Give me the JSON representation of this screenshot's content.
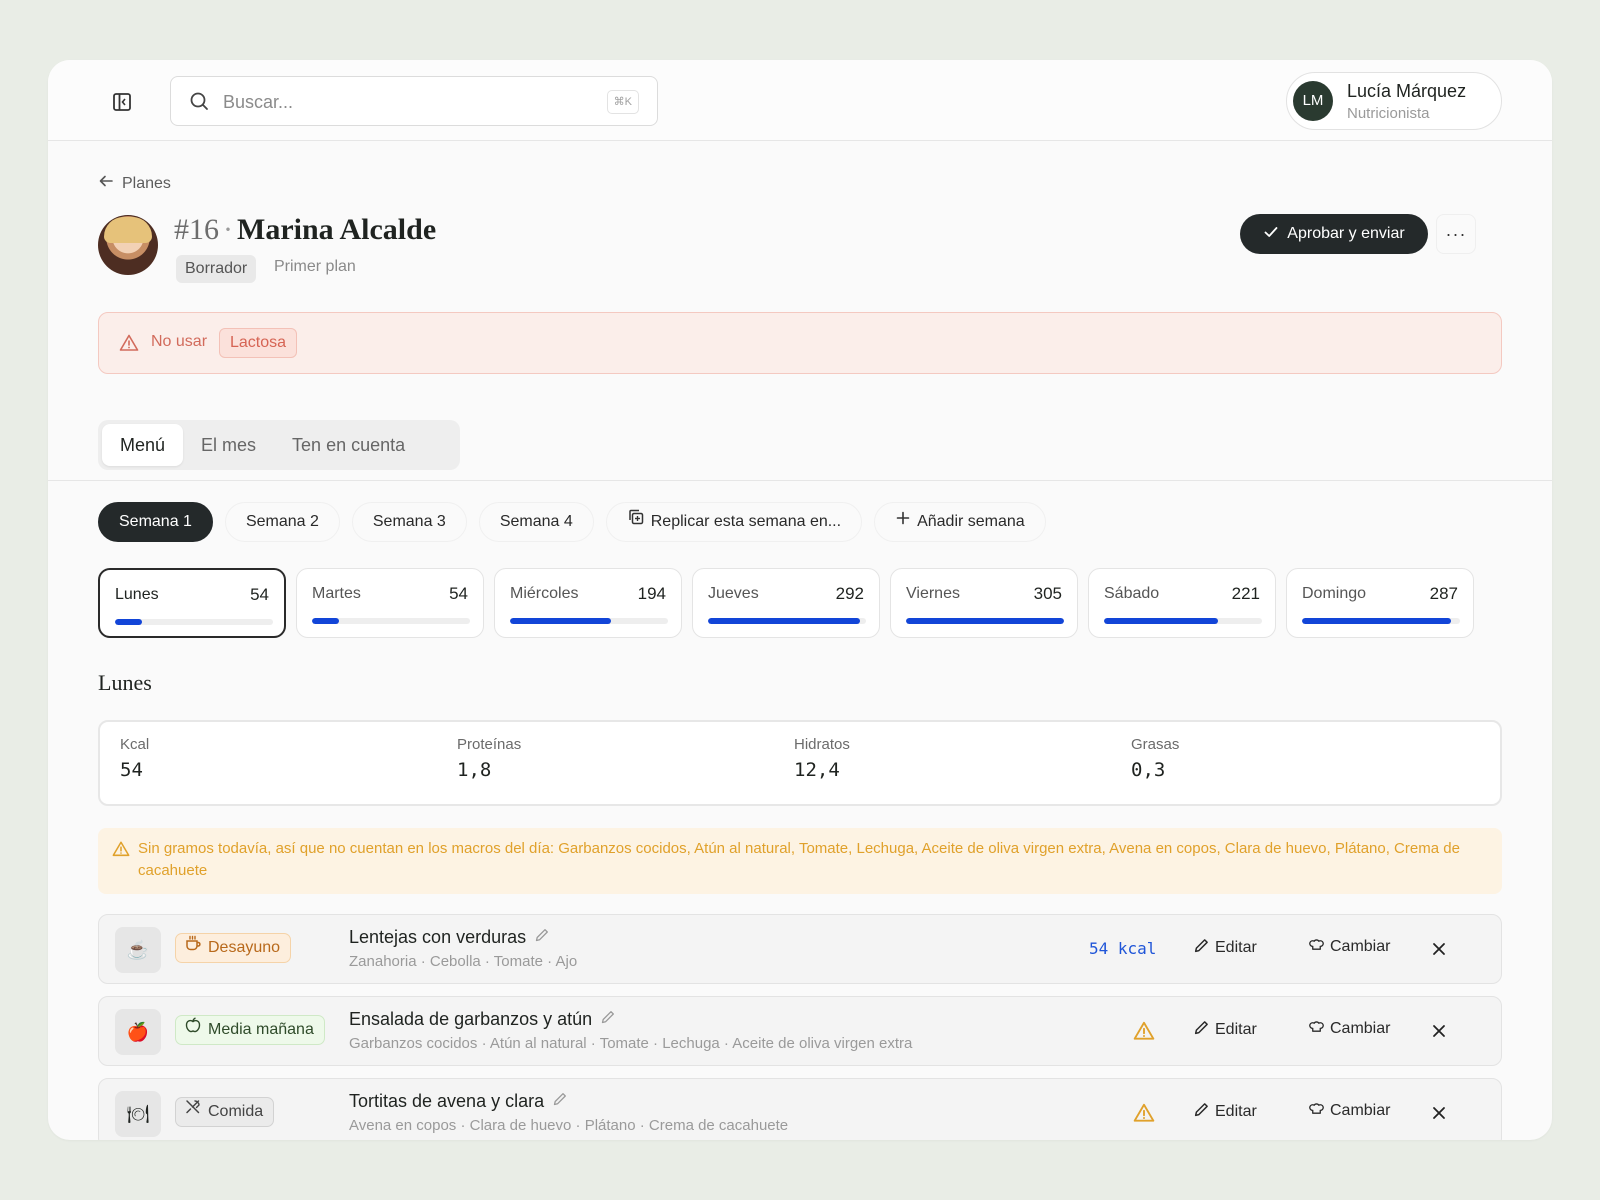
{
  "search": {
    "placeholder": "Buscar...",
    "shortcut": "⌘K"
  },
  "user": {
    "initials": "LM",
    "name": "Lucía Márquez",
    "role": "Nutricionista"
  },
  "breadcrumb": {
    "back_label": "Planes"
  },
  "plan": {
    "number": "#16",
    "separator": "·",
    "patient_name": "Marina Alcalde",
    "status": "Borrador",
    "type": "Primer plan",
    "approve_label": "Aprobar y enviar",
    "more_label": "···"
  },
  "restriction": {
    "label": "No usar",
    "item": "Lactosa"
  },
  "tabs": [
    {
      "label": "Menú",
      "active": true
    },
    {
      "label": "El mes",
      "active": false
    },
    {
      "label": "Ten en cuenta",
      "active": false
    }
  ],
  "weeks": [
    "Semana 1",
    "Semana 2",
    "Semana 3",
    "Semana 4"
  ],
  "week_actions": {
    "replicate": "Replicar esta semana en...",
    "add": "Añadir semana"
  },
  "days": [
    {
      "name": "Lunes",
      "kcal": "54",
      "progress": 0.17
    },
    {
      "name": "Martes",
      "kcal": "54",
      "progress": 0.17
    },
    {
      "name": "Miércoles",
      "kcal": "194",
      "progress": 0.64
    },
    {
      "name": "Jueves",
      "kcal": "292",
      "progress": 0.96
    },
    {
      "name": "Viernes",
      "kcal": "305",
      "progress": 1.0
    },
    {
      "name": "Sábado",
      "kcal": "221",
      "progress": 0.72
    },
    {
      "name": "Domingo",
      "kcal": "287",
      "progress": 0.94
    }
  ],
  "selected_day": {
    "title": "Lunes",
    "macros": [
      {
        "label": "Kcal",
        "value": "54"
      },
      {
        "label": "Proteínas",
        "value": "1,8"
      },
      {
        "label": "Hidratos",
        "value": "12,4"
      },
      {
        "label": "Grasas",
        "value": "0,3"
      }
    ]
  },
  "warning": "Sin gramos todavía, así que no cuentan en los macros del día: Garbanzos cocidos, Atún al natural, Tomate, Lechuga, Aceite de oliva virgen extra, Avena en copos, Clara de huevo, Plátano, Crema de cacahuete",
  "meals": [
    {
      "slot": "Desayuno",
      "emoji": "☕",
      "title": "Lentejas con verduras",
      "ingredients": "Zanahoria · Cebolla · Tomate · Ajo",
      "kcal": "54 kcal"
    },
    {
      "slot": "Media mañana",
      "emoji": "🍎",
      "title": "Ensalada de garbanzos y atún",
      "ingredients": "Garbanzos cocidos · Atún al natural · Tomate · Lechuga · Aceite de oliva virgen extra",
      "kcal": ""
    },
    {
      "slot": "Comida",
      "emoji": "🍽",
      "title": "Tortitas de avena y clara",
      "ingredients": "Avena en copos · Clara de huevo · Plátano · Crema de cacahuete",
      "kcal": ""
    }
  ],
  "meal_actions": {
    "edit": "Editar",
    "swap": "Cambiar"
  },
  "colors": {
    "accent": "#1245d8",
    "dark": "#24292a",
    "danger": "#d26b5c",
    "warning": "#e0a12b"
  },
  "icons": [
    "sidebar-toggle-icon",
    "search-icon",
    "arrow-left-icon",
    "check-icon",
    "alert-triangle-icon",
    "copy-icon",
    "plus-icon",
    "pencil-icon",
    "chef-hat-icon",
    "close-icon",
    "coffee-icon",
    "apple-icon",
    "utensils-icon"
  ]
}
